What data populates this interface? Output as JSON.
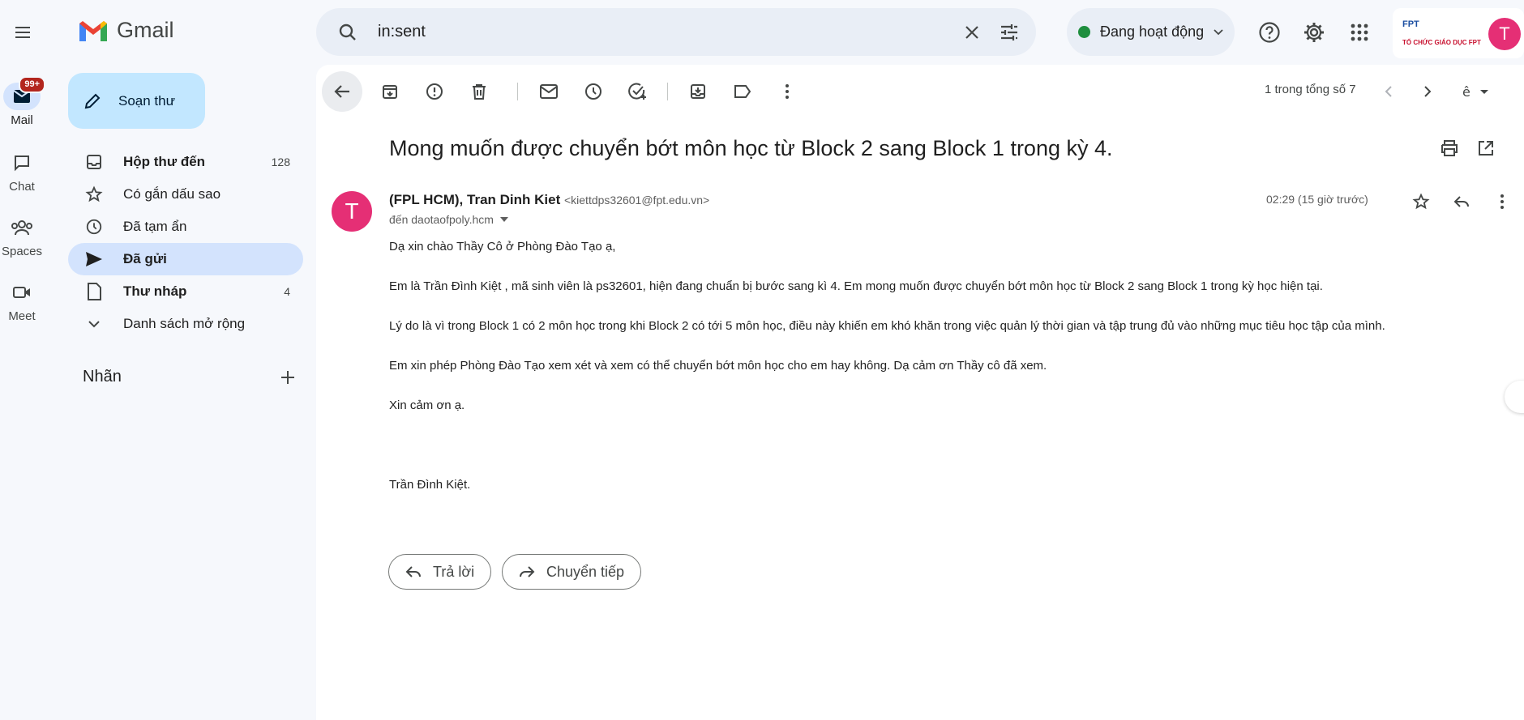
{
  "app": {
    "name": "Gmail"
  },
  "rail": {
    "mail_label": "Mail",
    "mail_badge": "99+",
    "chat_label": "Chat",
    "spaces_label": "Spaces",
    "meet_label": "Meet"
  },
  "compose": {
    "label": "Soạn thư"
  },
  "nav": {
    "items": [
      {
        "label": "Hộp thư đến",
        "count": "128",
        "icon": "inbox-icon"
      },
      {
        "label": "Có gắn dấu sao",
        "count": "",
        "icon": "star-icon"
      },
      {
        "label": "Đã tạm ẩn",
        "count": "",
        "icon": "clock-icon"
      },
      {
        "label": "Đã gửi",
        "count": "",
        "icon": "send-icon"
      },
      {
        "label": "Thư nháp",
        "count": "4",
        "icon": "draft-icon"
      },
      {
        "label": "Danh sách mở rộng",
        "count": "",
        "icon": "chevron-down-icon"
      }
    ],
    "labels_heading": "Nhãn"
  },
  "search": {
    "value": "in:sent"
  },
  "status": {
    "label": "Đang hoạt động",
    "color": "#1e8e3e"
  },
  "account": {
    "initial": "T",
    "brand_text": "TỔ CHỨC GIÁO DỤC FPT",
    "brand_mark": "FPT"
  },
  "toolbar": {
    "pager": "1 trong tổng số 7"
  },
  "email": {
    "subject": "Mong muốn được chuyển bớt môn học từ Block 2 sang Block 1 trong kỳ 4.",
    "sender_name": "(FPL HCM), Tran Dinh Kiet",
    "sender_email": "<kiettdps32601@fpt.edu.vn>",
    "to": "đến daotaofpoly.hcm",
    "time": "02:29 (15 giờ trước)",
    "avatar_initial": "T",
    "body": [
      "Dạ xin chào Thầy Cô ở Phòng Đào Tạo ạ,",
      "Em là Trần Đình Kiệt , mã sinh viên là ps32601, hiện đang chuẩn bị bước sang kì 4. Em mong muốn được chuyển bớt môn học từ Block 2 sang Block 1 trong kỳ học hiện tại.",
      "Lý do là vì trong Block 1 có 2 môn học trong khi Block 2 có tới 5 môn học, điều này khiến em khó khăn trong việc quản lý thời gian và tập trung đủ vào những mục tiêu học tập của mình.",
      "Em xin phép Phòng Đào Tạo xem xét và xem có thể chuyển bớt môn học cho em hay không. Dạ cảm ơn Thầy cô đã xem.",
      "Xin cảm ơn ạ.",
      "",
      "Trần Đình Kiệt."
    ]
  },
  "actions": {
    "reply_label": "Trả lời",
    "forward_label": "Chuyển tiếp"
  }
}
